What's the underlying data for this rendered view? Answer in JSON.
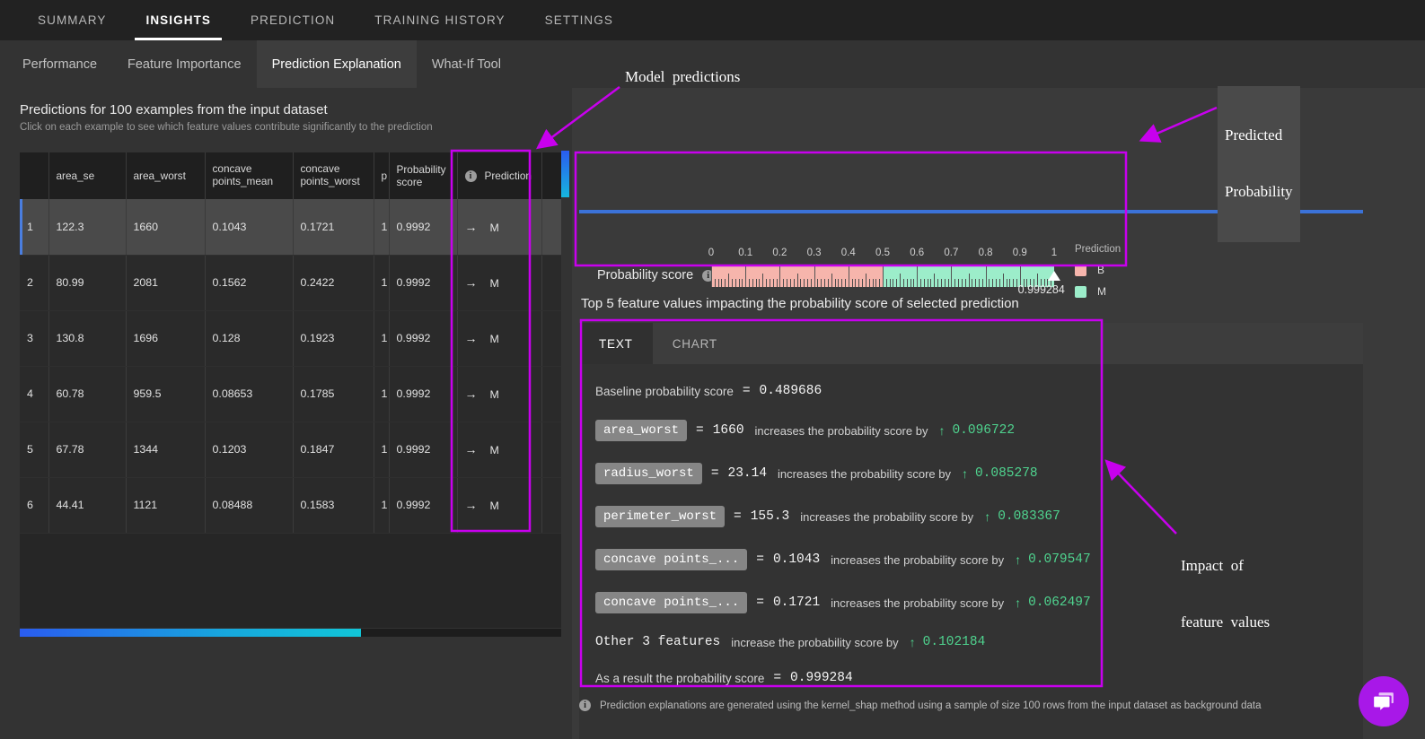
{
  "topnav": {
    "items": [
      {
        "label": "SUMMARY",
        "active": false
      },
      {
        "label": "INSIGHTS",
        "active": true
      },
      {
        "label": "PREDICTION",
        "active": false
      },
      {
        "label": "TRAINING HISTORY",
        "active": false
      },
      {
        "label": "SETTINGS",
        "active": false
      }
    ]
  },
  "subnav": {
    "items": [
      {
        "label": "Performance",
        "active": false
      },
      {
        "label": "Feature Importance",
        "active": false
      },
      {
        "label": "Prediction Explanation",
        "active": true
      },
      {
        "label": "What-If Tool",
        "active": false
      }
    ]
  },
  "left": {
    "title": "Predictions for 100 examples from the input dataset",
    "subtitle": "Click on each example to see which feature values contribute significantly to the prediction",
    "table": {
      "columns": [
        {
          "key": "idx",
          "label": ""
        },
        {
          "key": "area_se",
          "label": "area_se"
        },
        {
          "key": "area_worst",
          "label": "area_worst"
        },
        {
          "key": "concave_points_mean",
          "label_line1": "concave",
          "label_line2": "points_mean"
        },
        {
          "key": "concave_points_worst",
          "label_line1": "concave",
          "label_line2": "points_worst"
        },
        {
          "key": "truncated",
          "label": "p"
        },
        {
          "key": "probability_score",
          "label": "Probability score"
        },
        {
          "key": "prediction",
          "label": "Prediction",
          "info_icon": "info-icon"
        },
        {
          "key": "end",
          "label": ""
        }
      ],
      "rows": [
        {
          "idx": "1",
          "area_se": "122.3",
          "area_worst": "1660",
          "concave_points_mean": "0.1043",
          "concave_points_worst": "0.1721",
          "truncated": "1",
          "probability_score": "0.9992",
          "prediction": "M",
          "selected": true
        },
        {
          "idx": "2",
          "area_se": "80.99",
          "area_worst": "2081",
          "concave_points_mean": "0.1562",
          "concave_points_worst": "0.2422",
          "truncated": "1",
          "probability_score": "0.9992",
          "prediction": "M",
          "selected": false
        },
        {
          "idx": "3",
          "area_se": "130.8",
          "area_worst": "1696",
          "concave_points_mean": "0.128",
          "concave_points_worst": "0.1923",
          "truncated": "1",
          "probability_score": "0.9992",
          "prediction": "M",
          "selected": false
        },
        {
          "idx": "4",
          "area_se": "60.78",
          "area_worst": "959.5",
          "concave_points_mean": "0.08653",
          "concave_points_worst": "0.1785",
          "truncated": "1",
          "probability_score": "0.9992",
          "prediction": "M",
          "selected": false
        },
        {
          "idx": "5",
          "area_se": "67.78",
          "area_worst": "1344",
          "concave_points_mean": "0.1203",
          "concave_points_worst": "0.1847",
          "truncated": "1",
          "probability_score": "0.9992",
          "prediction": "M",
          "selected": false
        },
        {
          "idx": "6",
          "area_se": "44.41",
          "area_worst": "1121",
          "concave_points_mean": "0.08488",
          "concave_points_worst": "0.1583",
          "truncated": "1",
          "probability_score": "0.9992",
          "prediction": "M",
          "selected": false
        }
      ]
    }
  },
  "probability": {
    "label": "Probability score",
    "value": "0.999284",
    "value_num": 0.999284,
    "ticks": [
      "0",
      "0.1",
      "0.2",
      "0.3",
      "0.4",
      "0.5",
      "0.6",
      "0.7",
      "0.8",
      "0.9",
      "1"
    ],
    "legend_title": "Prediction",
    "legend": [
      {
        "label": "B",
        "color": "#f6b5ac"
      },
      {
        "label": "M",
        "color": "#9cedca"
      }
    ]
  },
  "explanation": {
    "title": "Top 5 feature values impacting the probability score of selected prediction",
    "tabs": [
      {
        "label": "TEXT",
        "active": true
      },
      {
        "label": "CHART",
        "active": false
      }
    ],
    "baseline_label": "Baseline probability score",
    "baseline_eq": "=",
    "baseline_value": "0.489686",
    "features": [
      {
        "name": "area_worst",
        "eq": "=",
        "value": "1660",
        "phrase": "increases the probability score by",
        "arrow": "↑",
        "delta": "0.096722"
      },
      {
        "name": "radius_worst",
        "eq": "=",
        "value": "23.14",
        "phrase": "increases the probability score by",
        "arrow": "↑",
        "delta": "0.085278"
      },
      {
        "name": "perimeter_worst",
        "eq": "=",
        "value": "155.3",
        "phrase": "increases the probability score by",
        "arrow": "↑",
        "delta": "0.083367"
      },
      {
        "name": "concave points_...",
        "eq": "=",
        "value": "0.1043",
        "phrase": "increases the probability score by",
        "arrow": "↑",
        "delta": "0.079547"
      },
      {
        "name": "concave points_...",
        "eq": "=",
        "value": "0.1721",
        "phrase": "increases the probability score by",
        "arrow": "↑",
        "delta": "0.062497"
      }
    ],
    "other": {
      "label": "Other 3 features",
      "phrase": "increase the probability score by",
      "arrow": "↑",
      "delta": "0.102184"
    },
    "result": {
      "label": "As a result the probability score",
      "eq": "=",
      "value": "0.999284"
    }
  },
  "footer": {
    "note": "Prediction explanations are generated using the kernel_shap method using a sample of size 100 rows from the input dataset as background data"
  },
  "annotations": [
    {
      "id": "model-predictions",
      "text": "Model  predictions"
    },
    {
      "id": "predicted-probability",
      "line1": "Predicted",
      "line2": "Probability"
    },
    {
      "id": "impact-of-feature-values",
      "line1": "Impact  of",
      "line2": "feature  values"
    }
  ],
  "colors": {
    "annotation": "#c800ee",
    "accent_blue": "#3b72d8",
    "positive_green": "#4fd48f",
    "class_b": "#f6b5ac",
    "class_m": "#9cedca",
    "chat_purple": "#a818e8"
  }
}
